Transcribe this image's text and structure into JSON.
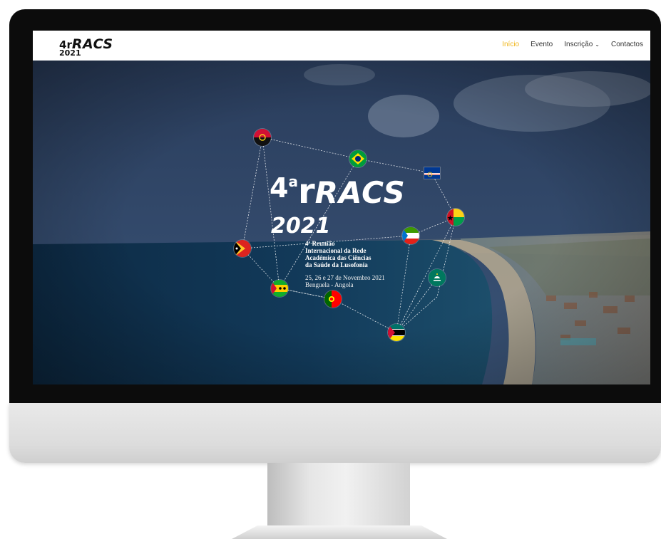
{
  "site": {
    "logo": {
      "prefix": "4",
      "mark": "r",
      "name": "RACS",
      "year": "2021"
    },
    "nav": {
      "items": [
        {
          "label": "Início",
          "active": true
        },
        {
          "label": "Evento",
          "active": false
        },
        {
          "label": "Inscrição",
          "active": false,
          "dropdown": true
        },
        {
          "label": "Contactos",
          "active": false
        }
      ]
    },
    "hero": {
      "title_number": "4",
      "title_sup": "a",
      "title_mark": "r",
      "title_name": "RACS",
      "year": "2021",
      "subtitle_lines": [
        "4ª Reunião",
        "Internacional da Rede",
        "Académica das Ciências",
        "da Saúde da Lusofonia"
      ],
      "date_lines": [
        "25, 26 e 27 de Novembro 2021",
        "Benguela - Angola"
      ],
      "flags": [
        "angola",
        "brazil",
        "cape-verde",
        "guinea-bissau",
        "equatorial-guinea",
        "east-timor",
        "macau",
        "sao-tome-and-principe",
        "portugal",
        "mozambique"
      ]
    }
  },
  "colors": {
    "accent": "#f0b61c",
    "nav_text": "#333333"
  }
}
